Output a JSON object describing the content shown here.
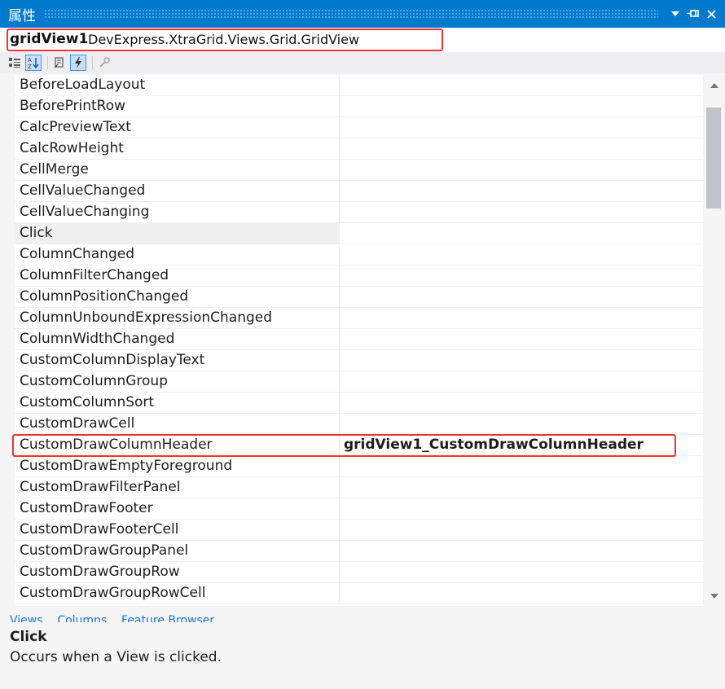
{
  "window": {
    "title": "属性",
    "dropdown_icon": "chevron-down-icon",
    "pin_icon": "pin-icon",
    "close_icon": "close-icon"
  },
  "object_selector": {
    "name": "gridView1",
    "type": "DevExpress.XtraGrid.Views.Grid.GridView"
  },
  "toolbar": {
    "buttons": [
      "categorized-icon",
      "alphabetical-icon",
      "properties-icon",
      "events-icon",
      "property-pages-icon"
    ]
  },
  "events": [
    {
      "name": "BeforeLoadLayout",
      "value": ""
    },
    {
      "name": "BeforePrintRow",
      "value": ""
    },
    {
      "name": "CalcPreviewText",
      "value": ""
    },
    {
      "name": "CalcRowHeight",
      "value": ""
    },
    {
      "name": "CellMerge",
      "value": ""
    },
    {
      "name": "CellValueChanged",
      "value": ""
    },
    {
      "name": "CellValueChanging",
      "value": ""
    },
    {
      "name": "Click",
      "value": ""
    },
    {
      "name": "ColumnChanged",
      "value": ""
    },
    {
      "name": "ColumnFilterChanged",
      "value": ""
    },
    {
      "name": "ColumnPositionChanged",
      "value": ""
    },
    {
      "name": "ColumnUnboundExpressionChanged",
      "value": ""
    },
    {
      "name": "ColumnWidthChanged",
      "value": ""
    },
    {
      "name": "CustomColumnDisplayText",
      "value": ""
    },
    {
      "name": "CustomColumnGroup",
      "value": ""
    },
    {
      "name": "CustomColumnSort",
      "value": ""
    },
    {
      "name": "CustomDrawCell",
      "value": ""
    },
    {
      "name": "CustomDrawColumnHeader",
      "value": "gridView1_CustomDrawColumnHeader"
    },
    {
      "name": "CustomDrawEmptyForeground",
      "value": ""
    },
    {
      "name": "CustomDrawFilterPanel",
      "value": ""
    },
    {
      "name": "CustomDrawFooter",
      "value": ""
    },
    {
      "name": "CustomDrawFooterCell",
      "value": ""
    },
    {
      "name": "CustomDrawGroupPanel",
      "value": ""
    },
    {
      "name": "CustomDrawGroupRow",
      "value": ""
    },
    {
      "name": "CustomDrawGroupRowCell",
      "value": ""
    }
  ],
  "selected_event": "Click",
  "highlighted_event": "CustomDrawColumnHeader",
  "command_links": "Views... Columns... Feature Browser...",
  "description": {
    "title": "Click",
    "text": "Occurs when a View is clicked."
  }
}
